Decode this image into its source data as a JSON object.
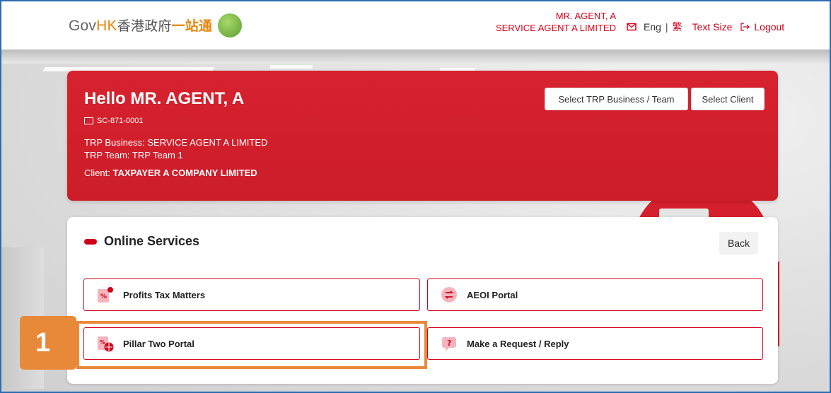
{
  "header": {
    "logo_gov": "Gov",
    "logo_hk": "HK",
    "logo_cn": "香港政府",
    "logo_cn2": "一站通",
    "user_name": "MR. AGENT, A",
    "user_company": "SERVICE AGENT A LIMITED",
    "lang_label": "Eng",
    "lang_sep": "|",
    "lang_tc": "繁",
    "text_size_label": "Text Size",
    "logout_label": "Logout"
  },
  "profile": {
    "greeting": "Hello MR. AGENT, A",
    "agent_id": "SC-871-0001",
    "trp_business": "TRP Business: SERVICE AGENT A LIMITED",
    "trp_team": "TRP Team: TRP Team 1",
    "client_label": "Client:",
    "client_name": "TAXPAYER A COMPANY LIMITED",
    "select_trp_button": "Select TRP Business / Team",
    "select_client_button": "Select Client"
  },
  "services": {
    "title": "Online Services",
    "back_label": "Back",
    "tiles": [
      {
        "label": "Profits Tax Matters",
        "icon": "profits-tax-icon"
      },
      {
        "label": "AEOI Portal",
        "icon": "aeoi-exchange-icon"
      },
      {
        "label": "Pillar Two Portal",
        "icon": "pillar-two-icon"
      },
      {
        "label": "Make a Request / Reply",
        "icon": "question-chat-icon"
      }
    ]
  },
  "callout": {
    "number": "1"
  },
  "colors": {
    "brand_red": "#d0021b",
    "callout_orange": "#e8893a",
    "gov_orange": "#e8850a"
  }
}
